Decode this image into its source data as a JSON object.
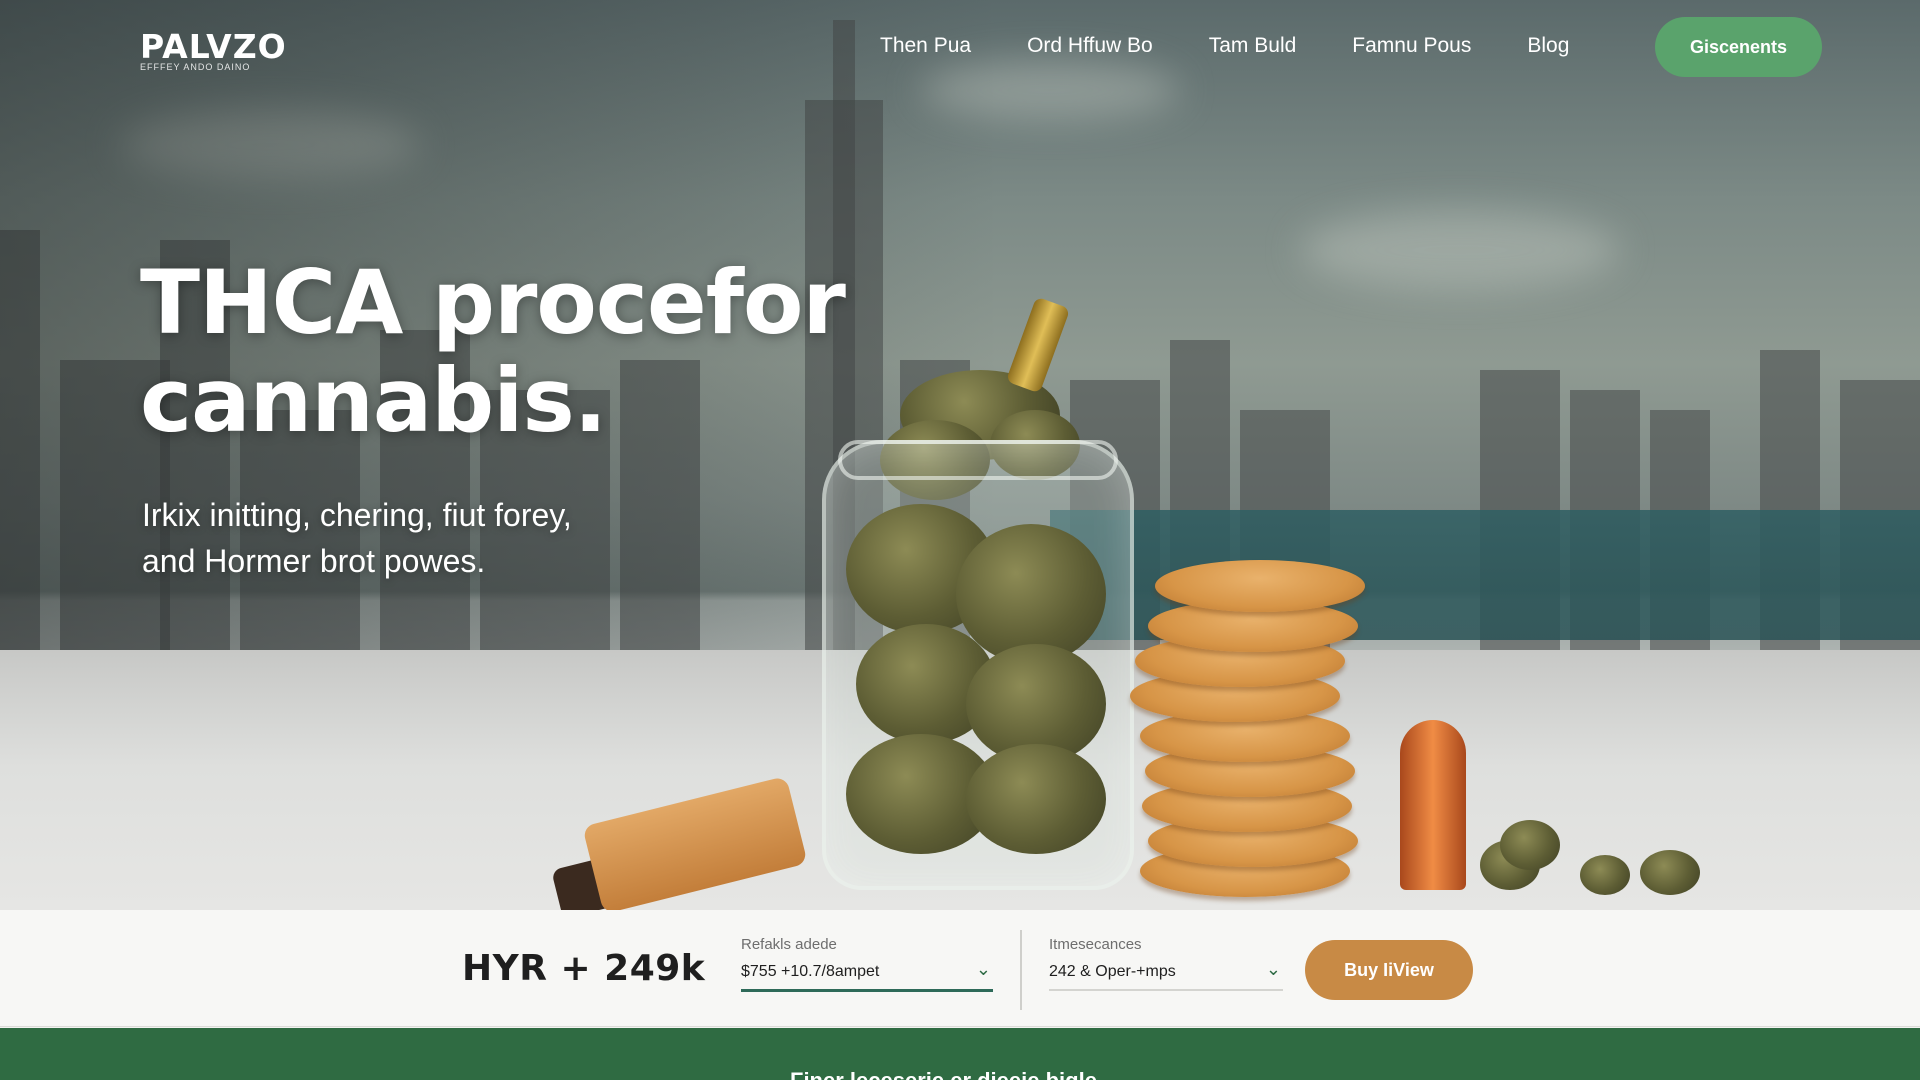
{
  "brand": {
    "logo": "PALVZO",
    "tagline": "EFFFEY ANDO DAINO"
  },
  "nav": {
    "links": [
      "Then Pua",
      "Ord Hffuw Bo",
      "Tam Buld",
      "Famnu Pous",
      "Blog"
    ],
    "cta_label": "Giscenents"
  },
  "hero": {
    "title_line1": "THCA procefor",
    "title_line2": "cannabis.",
    "subtitle_line1": "Irkix initting, chering, fiut forey,",
    "subtitle_line2": "and Hormer brot powes."
  },
  "purchase": {
    "price": "HYR + 249k",
    "field1": {
      "label": "Refakls adede",
      "value": "$755 +10.7/8ampet"
    },
    "field2": {
      "label": "Itmesecances",
      "value": "242 & Oper-+mps"
    },
    "buy_label": "Buy IiView"
  },
  "footer": {
    "text": "Finer leceserie er dieeie bigle"
  },
  "colors": {
    "accent_green": "#5aa36c",
    "buy_orange": "#c88a45",
    "footer_green": "#2f6b42"
  }
}
